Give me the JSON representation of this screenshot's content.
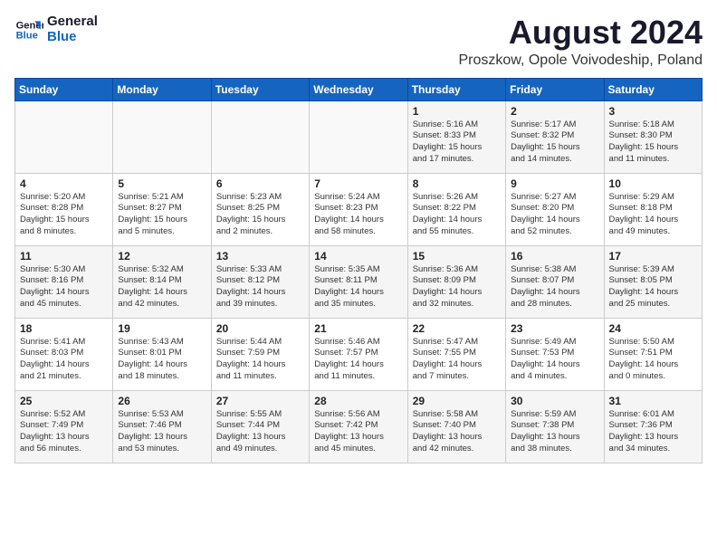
{
  "logo": {
    "line1": "General",
    "line2": "Blue"
  },
  "title": {
    "month_year": "August 2024",
    "location": "Proszkow, Opole Voivodeship, Poland"
  },
  "days_of_week": [
    "Sunday",
    "Monday",
    "Tuesday",
    "Wednesday",
    "Thursday",
    "Friday",
    "Saturday"
  ],
  "weeks": [
    [
      {
        "day": "",
        "info": ""
      },
      {
        "day": "",
        "info": ""
      },
      {
        "day": "",
        "info": ""
      },
      {
        "day": "",
        "info": ""
      },
      {
        "day": "1",
        "info": "Sunrise: 5:16 AM\nSunset: 8:33 PM\nDaylight: 15 hours\nand 17 minutes."
      },
      {
        "day": "2",
        "info": "Sunrise: 5:17 AM\nSunset: 8:32 PM\nDaylight: 15 hours\nand 14 minutes."
      },
      {
        "day": "3",
        "info": "Sunrise: 5:18 AM\nSunset: 8:30 PM\nDaylight: 15 hours\nand 11 minutes."
      }
    ],
    [
      {
        "day": "4",
        "info": "Sunrise: 5:20 AM\nSunset: 8:28 PM\nDaylight: 15 hours\nand 8 minutes."
      },
      {
        "day": "5",
        "info": "Sunrise: 5:21 AM\nSunset: 8:27 PM\nDaylight: 15 hours\nand 5 minutes."
      },
      {
        "day": "6",
        "info": "Sunrise: 5:23 AM\nSunset: 8:25 PM\nDaylight: 15 hours\nand 2 minutes."
      },
      {
        "day": "7",
        "info": "Sunrise: 5:24 AM\nSunset: 8:23 PM\nDaylight: 14 hours\nand 58 minutes."
      },
      {
        "day": "8",
        "info": "Sunrise: 5:26 AM\nSunset: 8:22 PM\nDaylight: 14 hours\nand 55 minutes."
      },
      {
        "day": "9",
        "info": "Sunrise: 5:27 AM\nSunset: 8:20 PM\nDaylight: 14 hours\nand 52 minutes."
      },
      {
        "day": "10",
        "info": "Sunrise: 5:29 AM\nSunset: 8:18 PM\nDaylight: 14 hours\nand 49 minutes."
      }
    ],
    [
      {
        "day": "11",
        "info": "Sunrise: 5:30 AM\nSunset: 8:16 PM\nDaylight: 14 hours\nand 45 minutes."
      },
      {
        "day": "12",
        "info": "Sunrise: 5:32 AM\nSunset: 8:14 PM\nDaylight: 14 hours\nand 42 minutes."
      },
      {
        "day": "13",
        "info": "Sunrise: 5:33 AM\nSunset: 8:12 PM\nDaylight: 14 hours\nand 39 minutes."
      },
      {
        "day": "14",
        "info": "Sunrise: 5:35 AM\nSunset: 8:11 PM\nDaylight: 14 hours\nand 35 minutes."
      },
      {
        "day": "15",
        "info": "Sunrise: 5:36 AM\nSunset: 8:09 PM\nDaylight: 14 hours\nand 32 minutes."
      },
      {
        "day": "16",
        "info": "Sunrise: 5:38 AM\nSunset: 8:07 PM\nDaylight: 14 hours\nand 28 minutes."
      },
      {
        "day": "17",
        "info": "Sunrise: 5:39 AM\nSunset: 8:05 PM\nDaylight: 14 hours\nand 25 minutes."
      }
    ],
    [
      {
        "day": "18",
        "info": "Sunrise: 5:41 AM\nSunset: 8:03 PM\nDaylight: 14 hours\nand 21 minutes."
      },
      {
        "day": "19",
        "info": "Sunrise: 5:43 AM\nSunset: 8:01 PM\nDaylight: 14 hours\nand 18 minutes."
      },
      {
        "day": "20",
        "info": "Sunrise: 5:44 AM\nSunset: 7:59 PM\nDaylight: 14 hours\nand 11 minutes."
      },
      {
        "day": "21",
        "info": "Sunrise: 5:46 AM\nSunset: 7:57 PM\nDaylight: 14 hours\nand 11 minutes."
      },
      {
        "day": "22",
        "info": "Sunrise: 5:47 AM\nSunset: 7:55 PM\nDaylight: 14 hours\nand 7 minutes."
      },
      {
        "day": "23",
        "info": "Sunrise: 5:49 AM\nSunset: 7:53 PM\nDaylight: 14 hours\nand 4 minutes."
      },
      {
        "day": "24",
        "info": "Sunrise: 5:50 AM\nSunset: 7:51 PM\nDaylight: 14 hours\nand 0 minutes."
      }
    ],
    [
      {
        "day": "25",
        "info": "Sunrise: 5:52 AM\nSunset: 7:49 PM\nDaylight: 13 hours\nand 56 minutes."
      },
      {
        "day": "26",
        "info": "Sunrise: 5:53 AM\nSunset: 7:46 PM\nDaylight: 13 hours\nand 53 minutes."
      },
      {
        "day": "27",
        "info": "Sunrise: 5:55 AM\nSunset: 7:44 PM\nDaylight: 13 hours\nand 49 minutes."
      },
      {
        "day": "28",
        "info": "Sunrise: 5:56 AM\nSunset: 7:42 PM\nDaylight: 13 hours\nand 45 minutes."
      },
      {
        "day": "29",
        "info": "Sunrise: 5:58 AM\nSunset: 7:40 PM\nDaylight: 13 hours\nand 42 minutes."
      },
      {
        "day": "30",
        "info": "Sunrise: 5:59 AM\nSunset: 7:38 PM\nDaylight: 13 hours\nand 38 minutes."
      },
      {
        "day": "31",
        "info": "Sunrise: 6:01 AM\nSunset: 7:36 PM\nDaylight: 13 hours\nand 34 minutes."
      }
    ]
  ]
}
